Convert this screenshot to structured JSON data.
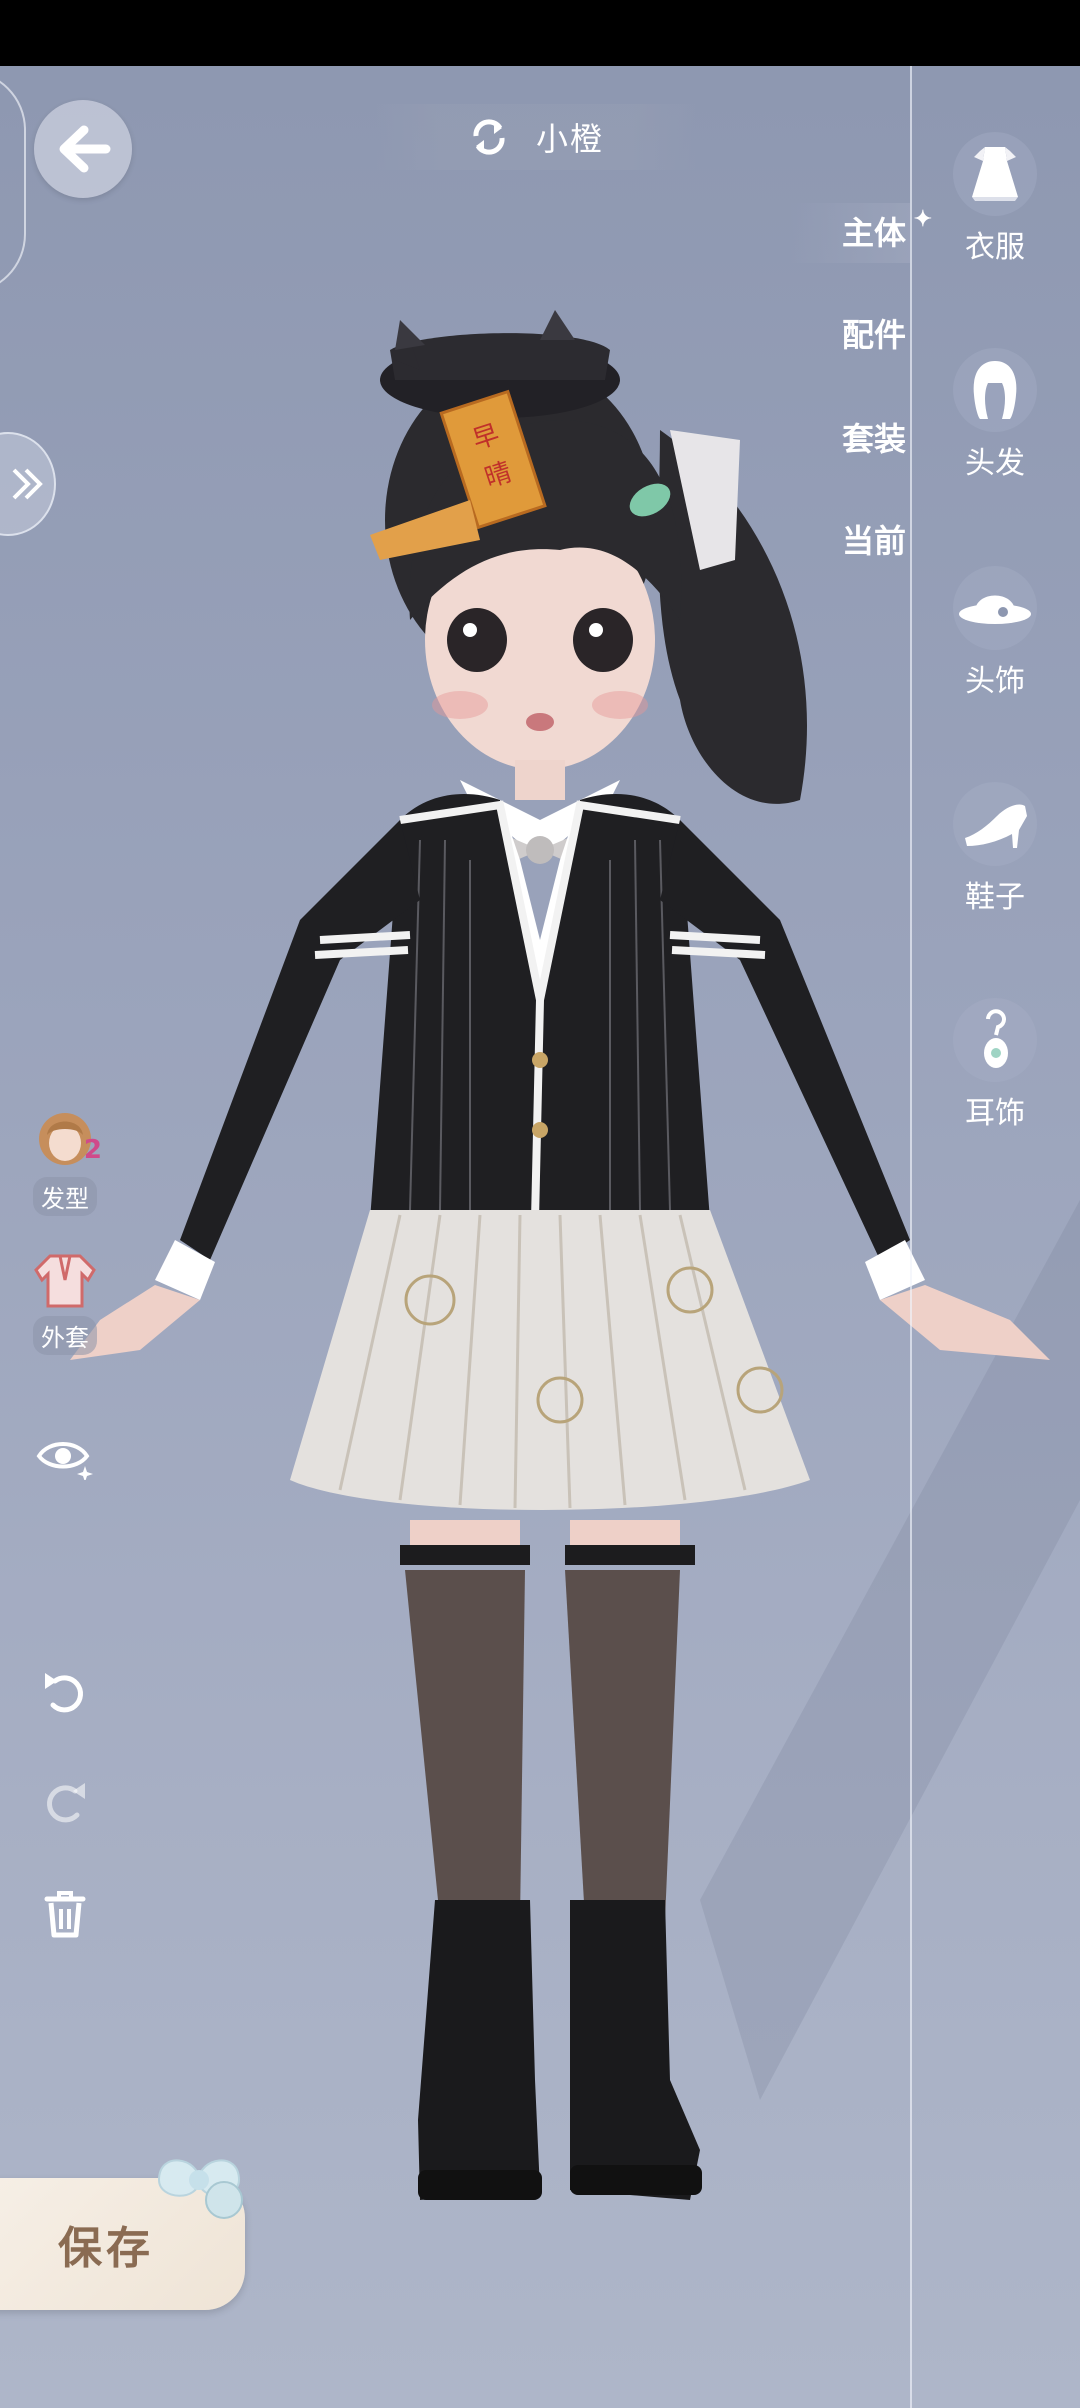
{
  "header": {
    "character_name": "小橙"
  },
  "category_tabs": [
    {
      "label": "主体",
      "active": true
    },
    {
      "label": "配件",
      "active": false
    },
    {
      "label": "套装",
      "active": false
    },
    {
      "label": "当前",
      "active": false
    }
  ],
  "side_categories": [
    {
      "label": "衣服",
      "icon": "dress-icon"
    },
    {
      "label": "头发",
      "icon": "hair-icon"
    },
    {
      "label": "头饰",
      "icon": "hat-icon"
    },
    {
      "label": "鞋子",
      "icon": "high-heel-icon"
    },
    {
      "label": "耳饰",
      "icon": "earring-icon"
    }
  ],
  "left_tools": {
    "hairstyle": {
      "label": "发型",
      "badge": "2"
    },
    "coat": {
      "label": "外套"
    }
  },
  "hat_badge_text": "早晴",
  "save_label": "保存",
  "colors": {
    "panel_bg": "#9aa3bb",
    "save_text": "#8a6b52",
    "badge": "#d04a8a"
  }
}
